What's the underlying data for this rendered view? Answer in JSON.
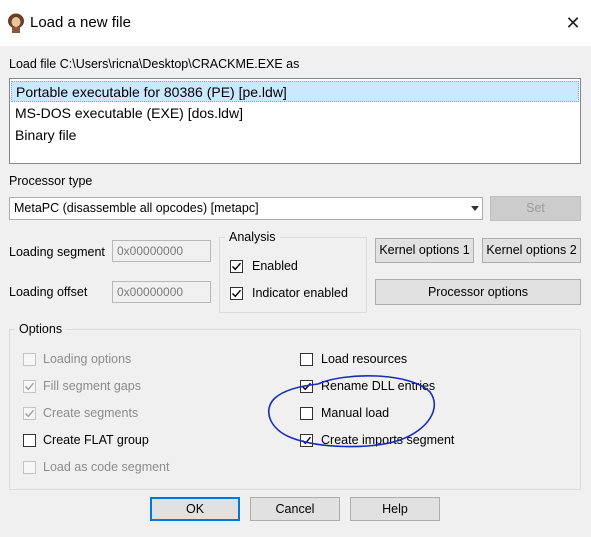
{
  "window": {
    "title": "Load a new file",
    "close_glyph": "✕"
  },
  "load_file_label": "Load file C:\\Users\\ricna\\Desktop\\CRACKME.EXE as",
  "file_types": [
    {
      "label": "Portable executable for 80386 (PE) [pe.ldw]",
      "selected": true
    },
    {
      "label": "MS-DOS executable (EXE) [dos.ldw]",
      "selected": false
    },
    {
      "label": "Binary file",
      "selected": false
    }
  ],
  "processor": {
    "label": "Processor type",
    "selected": "MetaPC (disassemble all opcodes) [metapc]",
    "set_button": "Set"
  },
  "loading_segment": {
    "label": "Loading segment",
    "value": "0x00000000"
  },
  "loading_offset": {
    "label": "Loading offset",
    "value": "0x00000000"
  },
  "analysis": {
    "title": "Analysis",
    "enabled": {
      "label": "Enabled",
      "checked": true
    },
    "indicator": {
      "label": "Indicator enabled",
      "checked": true
    }
  },
  "buttons": {
    "kernel1": "Kernel options 1",
    "kernel2": "Kernel options 2",
    "processor_options": "Processor options",
    "ok": "OK",
    "cancel": "Cancel",
    "help": "Help"
  },
  "options": {
    "title": "Options",
    "loading_options": {
      "label": "Loading options",
      "checked": false,
      "disabled": true
    },
    "fill_segment_gaps": {
      "label": "Fill segment gaps",
      "checked": true,
      "disabled": true
    },
    "create_segments": {
      "label": "Create segments",
      "checked": true,
      "disabled": true
    },
    "create_flat_group": {
      "label": "Create FLAT group",
      "checked": false,
      "disabled": false
    },
    "load_as_code_segment": {
      "label": "Load as code segment",
      "checked": false,
      "disabled": true
    },
    "load_resources": {
      "label": "Load resources",
      "checked": false,
      "disabled": false
    },
    "rename_dll_entries": {
      "label": "Rename DLL entries",
      "checked": true,
      "disabled": false
    },
    "manual_load": {
      "label": "Manual load",
      "checked": false,
      "disabled": false
    },
    "create_imports_segment": {
      "label": "Create imports segment",
      "checked": true,
      "disabled": false
    }
  },
  "colors": {
    "selection": "#cce8ff",
    "annotation_ink": "#1a2bb8",
    "default_button_border": "#0078d7"
  },
  "icons": {
    "app": "ida-app-icon",
    "close": "close-icon",
    "dropdown": "chevron-down-icon",
    "check": "check-icon"
  }
}
